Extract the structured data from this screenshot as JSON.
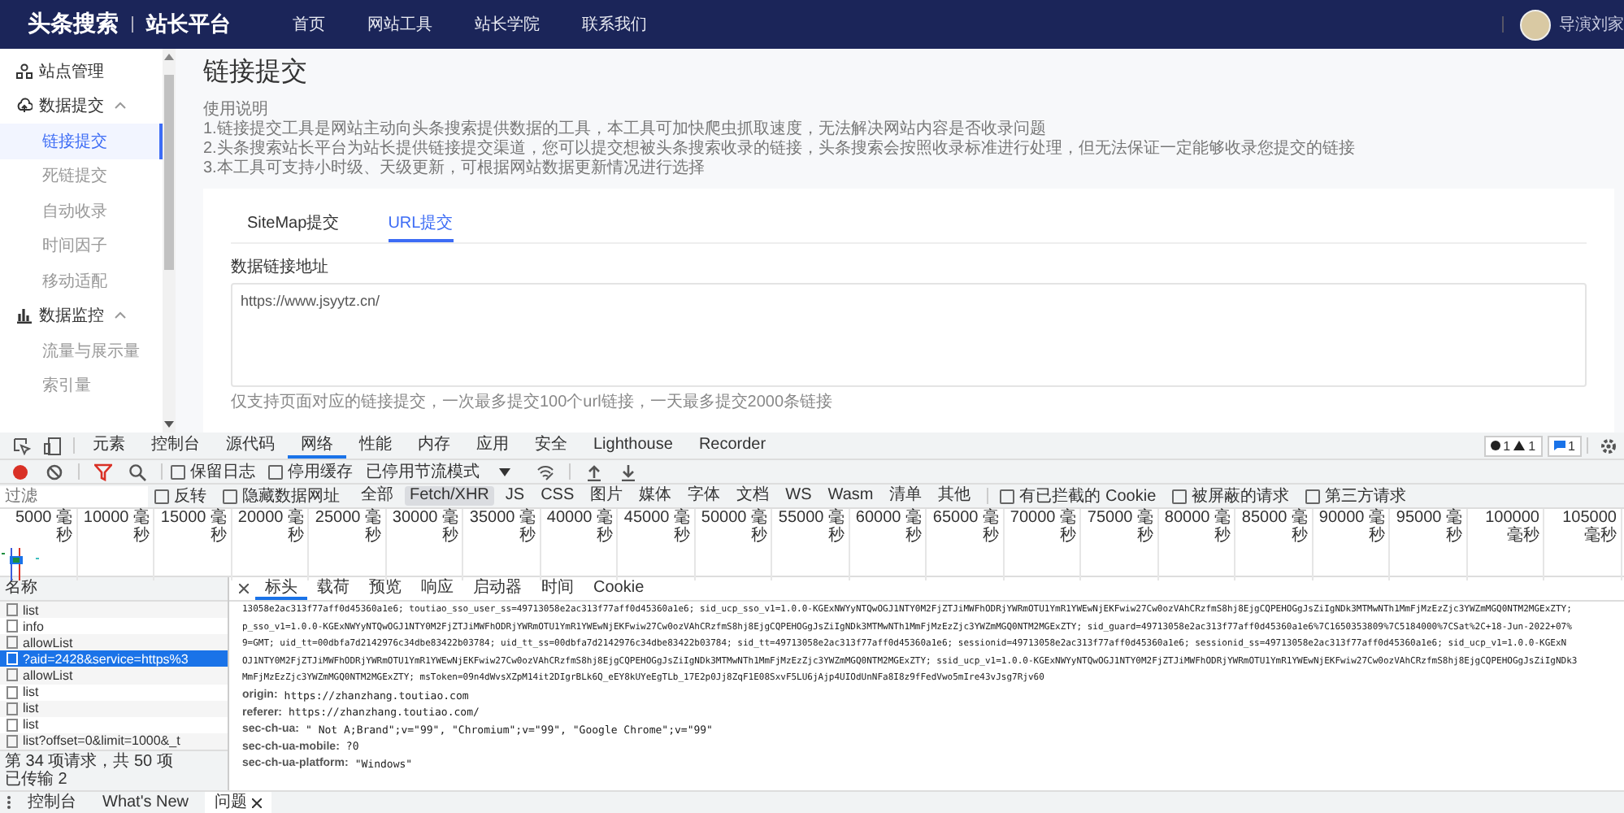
{
  "nav": {
    "logo": "头条搜索",
    "product": "站长平台",
    "links": [
      "首页",
      "网站工具",
      "站长学院",
      "联系我们"
    ],
    "user": "导演刘家"
  },
  "sidebar": {
    "items": [
      {
        "kind": "link",
        "label": "站点管理"
      },
      {
        "kind": "group",
        "label": "数据提交",
        "expanded": true,
        "children": [
          {
            "label": "链接提交",
            "selected": true
          },
          {
            "label": "死链提交",
            "selected": false
          },
          {
            "label": "自动收录",
            "selected": false
          },
          {
            "label": "时间因子",
            "selected": false
          },
          {
            "label": "移动适配",
            "selected": false
          }
        ]
      },
      {
        "kind": "group",
        "label": "数据监控",
        "expanded": true,
        "children": [
          {
            "label": "流量与展示量",
            "selected": false
          },
          {
            "label": "索引量",
            "selected": false
          }
        ]
      }
    ]
  },
  "main": {
    "title": "链接提交",
    "help_title": "使用说明",
    "help_lines": [
      "1.链接提交工具是网站主动向头条搜索提供数据的工具，本工具可加快爬虫抓取速度，无法解决网站内容是否收录问题",
      "2.头条搜索站长平台为站长提供链接提交渠道，您可以提交想被头条搜索收录的链接，头条搜索会按照收录标准进行处理，但无法保证一定能够收录您提交的链接",
      "3.本工具可支持小时级、天级更新，可根据网站数据更新情况进行选择"
    ],
    "tabs": [
      {
        "label": "SiteMap提交",
        "selected": false
      },
      {
        "label": "URL提交",
        "selected": true
      }
    ],
    "field": {
      "label": "数据链接地址",
      "value": "https://www.jsyytz.cn/"
    },
    "hint": "仅支持页面对应的链接提交，一次最多提交100个url链接，一天最多提交2000条链接"
  },
  "devtools": {
    "panels": [
      {
        "label": "元素",
        "selected": false
      },
      {
        "label": "控制台",
        "selected": false
      },
      {
        "label": "源代码",
        "selected": false
      },
      {
        "label": "网络",
        "selected": true
      },
      {
        "label": "性能",
        "selected": false
      },
      {
        "label": "内存",
        "selected": false
      },
      {
        "label": "应用",
        "selected": false
      },
      {
        "label": "安全",
        "selected": false
      },
      {
        "label": "Lighthouse",
        "selected": false
      },
      {
        "label": "Recorder",
        "selected": false
      }
    ],
    "badges": {
      "errors": "1",
      "warnings": "1",
      "messages": "1"
    },
    "toolbar": {
      "options": [
        {
          "label": "保留日志",
          "checked": false
        },
        {
          "label": "停用缓存",
          "checked": false
        }
      ],
      "throttle": "已停用节流模式"
    },
    "filter": {
      "placeholder": "过滤",
      "options": [
        {
          "label": "反转",
          "checked": false
        },
        {
          "label": "隐藏数据网址",
          "checked": false
        }
      ],
      "types": [
        {
          "label": "全部",
          "selected": false
        },
        {
          "label": "Fetch/XHR",
          "selected": true
        },
        {
          "label": "JS",
          "selected": false
        },
        {
          "label": "CSS",
          "selected": false
        },
        {
          "label": "图片",
          "selected": false
        },
        {
          "label": "媒体",
          "selected": false
        },
        {
          "label": "字体",
          "selected": false
        },
        {
          "label": "文档",
          "selected": false
        },
        {
          "label": "WS",
          "selected": false
        },
        {
          "label": "Wasm",
          "selected": false
        },
        {
          "label": "清单",
          "selected": false
        },
        {
          "label": "其他",
          "selected": false
        }
      ],
      "extra": [
        {
          "label": "有已拦截的 Cookie",
          "checked": false
        },
        {
          "label": "被屏蔽的请求",
          "checked": false
        },
        {
          "label": "第三方请求",
          "checked": false
        }
      ]
    },
    "timeline": {
      "ticks": [
        "5000 毫秒",
        "10000 毫秒",
        "15000 毫秒",
        "20000 毫秒",
        "25000 毫秒",
        "30000 毫秒",
        "35000 毫秒",
        "40000 毫秒",
        "45000 毫秒",
        "50000 毫秒",
        "55000 毫秒",
        "60000 毫秒",
        "65000 毫秒",
        "70000 毫秒",
        "75000 毫秒",
        "80000 毫秒",
        "85000 毫秒",
        "90000 毫秒",
        "95000 毫秒",
        "100000 毫秒",
        "105000 毫秒"
      ]
    },
    "requests": {
      "header": "名称",
      "items": [
        {
          "name": "list",
          "selected": false
        },
        {
          "name": "info",
          "selected": false
        },
        {
          "name": "allowList",
          "selected": false
        },
        {
          "name": "?aid=2428&service=https%3",
          "selected": true
        },
        {
          "name": "allowList",
          "selected": false
        },
        {
          "name": "list",
          "selected": false
        },
        {
          "name": "list",
          "selected": false
        },
        {
          "name": "list",
          "selected": false
        },
        {
          "name": "list?offset=0&limit=1000&_t",
          "selected": false
        }
      ],
      "status": [
        "第 34 项请求，共 50 项",
        "已传输 2"
      ]
    },
    "details": {
      "tabs": [
        {
          "label": "标头",
          "selected": true
        },
        {
          "label": "载荷",
          "selected": false
        },
        {
          "label": "预览",
          "selected": false
        },
        {
          "label": "响应",
          "selected": false
        },
        {
          "label": "启动器",
          "selected": false
        },
        {
          "label": "时间",
          "selected": false
        },
        {
          "label": "Cookie",
          "selected": false
        }
      ],
      "cookie_lines": [
        "13058e2ac313f77aff0d45360a1e6; toutiao_sso_user_ss=49713058e2ac313f77aff0d45360a1e6; sid_ucp_sso_v1=1.0.0-KGExNWYyNTQwOGJ1NTY0M2FjZTJiMWFhODRjYWRmOTU1YmR1YWEwNjEKFwiw27Cw0ozVAhCRzfmS8hj8EjgCQPEHOGgJsZiIgNDk3MTMwNTh1MmFjMzEzZjc3YWZmMGQ0NTM2MGExZTY;",
        "p_sso_v1=1.0.0-KGExNWYyNTQwOGJ1NTY0M2FjZTJiMWFhODRjYWRmOTU1YmR1YWEwNjEKFwiw27Cw0ozVAhCRzfmS8hj8EjgCQPEHOGgJsZiIgNDk3MTMwNTh1MmFjMzEzZjc3YWZmMGQ0NTM2MGExZTY; sid_guard=49713058e2ac313f77aff0d45360a1e6%7C1650353809%7C5184000%7CSat%2C+18-Jun-2022+07%",
        "9=GMT; uid_tt=00dbfa7d2142976c34dbe83422b03784; uid_tt_ss=00dbfa7d2142976c34dbe83422b03784; sid_tt=49713058e2ac313f77aff0d45360a1e6; sessionid=49713058e2ac313f77aff0d45360a1e6; sessionid_ss=49713058e2ac313f77aff0d45360a1e6; sid_ucp_v1=1.0.0-KGExN",
        "OJ1NTY0M2FjZTJiMWFhODRjYWRmOTU1YmR1YWEwNjEKFwiw27Cw0ozVAhCRzfmS8hj8EjgCQPEHOGgJsZiIgNDk3MTMwNTh1MmFjMzEzZjc3YWZmMGQ0NTM2MGExZTY; ssid_ucp_v1=1.0.0-KGExNWYyNTQwOGJ1NTY0M2FjZTJiMWFhODRjYWRmOTU1YmR1YWEwNjEKFwiw27Cw0ozVAhCRzfmS8hj8EjgCQPEHOGgJsZiIgNDk3",
        "MmFjMzEzZjc3YWZmMGQ0NTM2MGExZTY; msToken=09n4dWvsXZpM14it2DIgrBLk6Q_eEY8kUYeEgTLb_17E2p0Jj8ZqF1E08SxvF5LU6jAjp4UIOdUnNFa8I8z9fFedVwo5mIre43vJsg7Rjv60"
      ],
      "headers": [
        {
          "name": "origin:",
          "value": "https://zhanzhang.toutiao.com"
        },
        {
          "name": "referer:",
          "value": "https://zhanzhang.toutiao.com/"
        },
        {
          "name": "sec-ch-ua:",
          "value": "\" Not A;Brand\";v=\"99\", \"Chromium\";v=\"99\", \"Google Chrome\";v=\"99\""
        },
        {
          "name": "sec-ch-ua-mobile:",
          "value": "?0"
        },
        {
          "name": "sec-ch-ua-platform:",
          "value": "\"Windows\""
        }
      ]
    },
    "drawer": {
      "tabs": [
        {
          "label": "控制台",
          "selected": false,
          "closable": false
        },
        {
          "label": "What's New",
          "selected": false,
          "closable": false
        },
        {
          "label": "问题",
          "selected": true,
          "closable": true
        }
      ]
    }
  }
}
